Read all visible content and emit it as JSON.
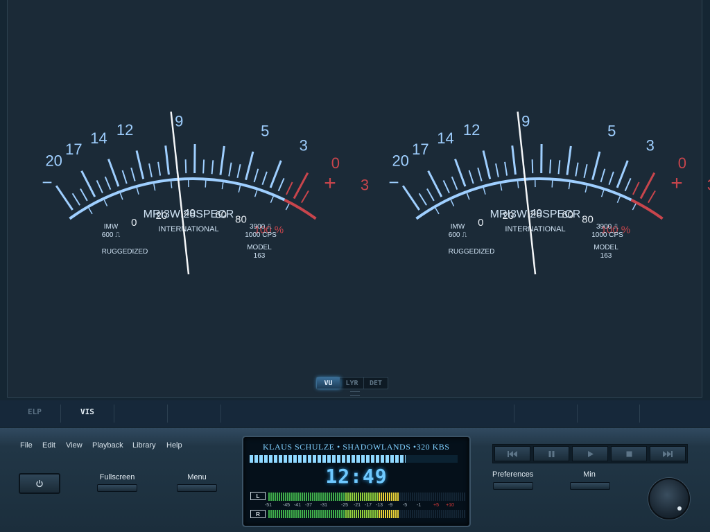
{
  "meter_face": {
    "top_scale": [
      "20",
      "17",
      "14",
      "12",
      "9",
      "5",
      "3",
      "0",
      "3"
    ],
    "bottom_scale": [
      "0",
      "20",
      "40",
      "60",
      "80",
      "100 %"
    ],
    "minus_sign": "−",
    "plus_sign": "+",
    "brand": "MRI3WI28SPECR",
    "company": "INTERNATIONAL",
    "spec_left": [
      "IMW",
      "600 ⎍"
    ],
    "spec_right": [
      "3900 ⎍",
      "1000 CPS"
    ],
    "rugged": "RUGGEDIZED",
    "model": [
      "MODEL",
      "163"
    ],
    "needle_level": "9"
  },
  "meters": [
    {
      "name": "left",
      "needle_level": "9"
    },
    {
      "name": "right",
      "needle_level": "9"
    }
  ],
  "view_tabs": [
    {
      "label": "VU",
      "active": true
    },
    {
      "label": "LYR",
      "active": false
    },
    {
      "label": "DET",
      "active": false
    }
  ],
  "nav": [
    {
      "label": "ELP",
      "active": false
    },
    {
      "label": "VIS",
      "active": true
    }
  ],
  "menu": [
    "File",
    "Edit",
    "View",
    "Playback",
    "Library",
    "Help"
  ],
  "buttons": {
    "fullscreen": "Fullscreen",
    "menu": "Menu",
    "preferences": "Preferences",
    "min": "Min"
  },
  "display": {
    "track": "KLAUS SCHULZE • SHADOWLANDS •320 KBS",
    "seek_progress": 0.75,
    "time": "12:49",
    "channels": [
      "L",
      "R"
    ],
    "levels": {
      "L": 0.66,
      "R": 0.66
    },
    "level_scale": [
      "-51",
      "-45",
      "-41",
      "-37",
      "-31",
      "-25",
      "-21",
      "-17",
      "-13",
      "-9",
      "-5",
      "-1",
      "+5",
      "+10"
    ]
  },
  "transport": [
    "prev-icon",
    "pause-icon",
    "play-icon",
    "stop-icon",
    "next-icon"
  ],
  "colors": {
    "scale_blue": "#9fcfff",
    "scale_red": "#c8454c",
    "accent": "#6fc9ff"
  }
}
